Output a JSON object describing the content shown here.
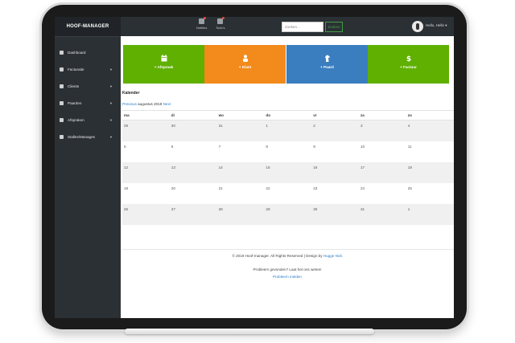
{
  "app": {
    "brand": "HOOF-MANAGER"
  },
  "topbar": {
    "notifications_label": "Notities",
    "todos_label": "Todo's",
    "search_placeholder": "Zoeken...",
    "search_button": "Zoeken",
    "user_label": "Hello, Hello"
  },
  "sidebar": {
    "items": [
      {
        "label": "Dashboard",
        "icon": "home-icon",
        "has_caret": false
      },
      {
        "label": "Facturatie",
        "icon": "invoice-icon",
        "has_caret": true
      },
      {
        "label": "Clients",
        "icon": "users-icon",
        "has_caret": true
      },
      {
        "label": "Paarden",
        "icon": "horse-icon",
        "has_caret": true
      },
      {
        "label": "Afspraken",
        "icon": "calendar-icon",
        "has_caret": true
      },
      {
        "label": "Stalles/Manages",
        "icon": "stable-icon",
        "has_caret": true
      }
    ]
  },
  "tiles": [
    {
      "label": "+ Afspraak",
      "icon": "calendar-icon",
      "color": "#5fb000"
    },
    {
      "label": "+ Klant",
      "icon": "user-icon",
      "color": "#f28a1c"
    },
    {
      "label": "+ Paard",
      "icon": "horse-icon",
      "color": "#3a7ebf"
    },
    {
      "label": "+ Factuur",
      "icon": "dollar-icon",
      "color": "#5fb000"
    }
  ],
  "calendar": {
    "title": "Kalender",
    "prev_label": "Previous",
    "month_label": "augustus 2019",
    "next_label": "Next",
    "weekdays": [
      "ma",
      "di",
      "wo",
      "do",
      "vr",
      "za",
      "zo"
    ],
    "weeks": [
      [
        "29",
        "30",
        "31",
        "1",
        "2",
        "3",
        "4"
      ],
      [
        "5",
        "6",
        "7",
        "8",
        "9",
        "10",
        "11"
      ],
      [
        "12",
        "13",
        "14",
        "15",
        "16",
        "17",
        "18"
      ],
      [
        "19",
        "20",
        "21",
        "22",
        "23",
        "24",
        "25"
      ],
      [
        "26",
        "27",
        "28",
        "29",
        "30",
        "31",
        "1"
      ]
    ]
  },
  "footer": {
    "copyright": "© 2019 Hoof-manager. All Rights Reserved | Design by",
    "designer": "Hugge Nick",
    "problem_text": "Probleem gevonden? Laat het ons weten!",
    "problem_link": "Probleem melden"
  },
  "colors": {
    "sidebar": "#2b3035",
    "brand_bg": "#202428",
    "link": "#2f80c9"
  }
}
